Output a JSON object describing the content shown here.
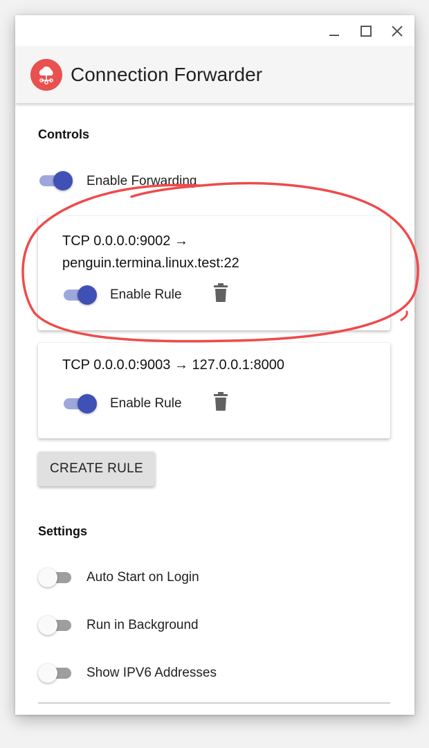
{
  "window": {
    "controls": [
      "minimize",
      "maximize",
      "close"
    ]
  },
  "app": {
    "title": "Connection Forwarder",
    "logo_icon": "cloud-network-icon",
    "accent_color": "#3f51b5",
    "logo_color": "#e8514f"
  },
  "controls": {
    "heading": "Controls",
    "enable_forwarding": {
      "label": "Enable Forwarding",
      "enabled": true
    }
  },
  "rules": [
    {
      "text": "TCP 0.0.0.0:9002 → penguin.termina.linux.test:22",
      "toggle_label": "Enable Rule",
      "enabled": true
    },
    {
      "text": "TCP 0.0.0.0:9003 → 127.0.0.1:8000",
      "toggle_label": "Enable Rule",
      "enabled": true
    }
  ],
  "create_button": "CREATE RULE",
  "settings": {
    "heading": "Settings",
    "items": [
      {
        "label": "Auto Start on Login",
        "enabled": false
      },
      {
        "label": "Run in Background",
        "enabled": false
      },
      {
        "label": "Show IPV6 Addresses",
        "enabled": false
      }
    ]
  },
  "annotation_color": "#ef4a4a"
}
